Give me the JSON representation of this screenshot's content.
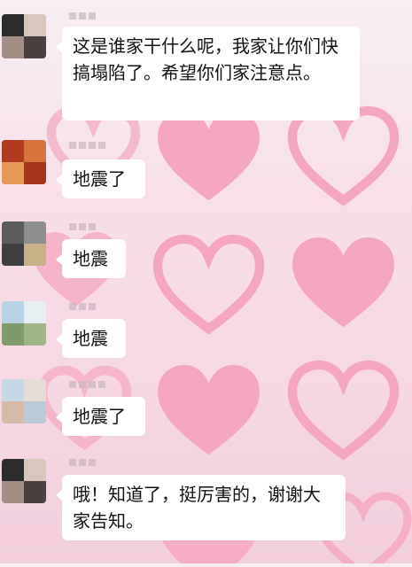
{
  "chat": {
    "messages": [
      {
        "text": "这是谁家干什么呢，我家让你们快搞塌陷了。希望你们家注意点。"
      },
      {
        "text": "地震了"
      },
      {
        "text": "地震"
      },
      {
        "text": "地震"
      },
      {
        "text": "地震了"
      },
      {
        "text": "哦！知道了，挺厉害的，谢谢大家告知。"
      }
    ]
  },
  "colors": {
    "heart": "#f4a6bf",
    "bubble": "#ffffff",
    "text": "#111111"
  }
}
